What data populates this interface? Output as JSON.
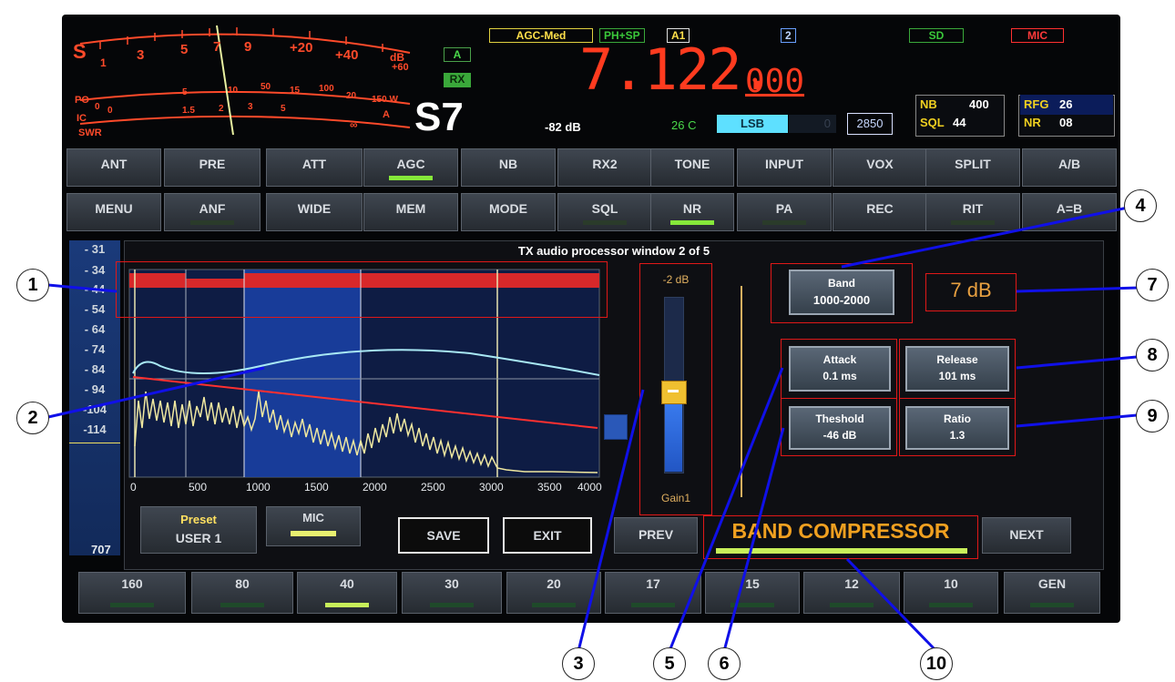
{
  "meter": {
    "s_label": "S",
    "s_scale": [
      "1",
      "3",
      "5",
      "7",
      "9",
      "+20",
      "+40",
      "dB"
    ],
    "db60": "+60",
    "po_label": "PO",
    "po_scale": [
      "0",
      "5",
      "10",
      "50",
      "15",
      "100",
      "20",
      "150 W"
    ],
    "ic_label": "IC",
    "ic_scale": [
      "0",
      "1.5",
      "2",
      "3",
      "5",
      "A"
    ],
    "swr_label": "SWR",
    "swr_inf": "∞",
    "s_reading": "S7",
    "db_reading": "-82 dB"
  },
  "status": {
    "vfo_a": "A",
    "rx": "RX",
    "agc": "AGC-Med",
    "phsp": "PH+SP",
    "a1": "A1",
    "two": "2",
    "sd": "SD",
    "mic": "MIC",
    "frequency_main": "7.122.",
    "frequency_sub": "000",
    "temp": "26 C",
    "mode": "LSB",
    "mode_zero": "0",
    "bandwidth": "2850",
    "nb_label": "NB",
    "nb_value": "400",
    "sql_label": "SQL",
    "sql_value": "44",
    "rfg_label": "RFG",
    "rfg_value": "26",
    "nr_label": "NR",
    "nr_value": "08"
  },
  "row1": [
    "ANT",
    "PRE",
    "ATT",
    "AGC",
    "NB",
    "RX2",
    "TONE",
    "INPUT",
    "VOX",
    "SPLIT",
    "A/B"
  ],
  "row2": [
    "MENU",
    "ANF",
    "WIDE",
    "MEM",
    "MODE",
    "SQL",
    "NR",
    "PA",
    "REC",
    "RIT",
    "A=B"
  ],
  "panel": {
    "title": "TX audio processor window 2 of 5",
    "y_labels": [
      "- 31",
      "- 34",
      "- 44",
      "- 54",
      "- 64",
      "- 74",
      "- 84",
      "- 94",
      "-104",
      "-114"
    ],
    "x_labels": [
      "0",
      "500",
      "1000",
      "1500",
      "2000",
      "2500",
      "3000",
      "3500",
      "4000"
    ],
    "slider_top": "-2 dB",
    "slider_bottom": "Gain1",
    "band_label": "Band",
    "band_value": "1000-2000",
    "gain_readout": "7  dB",
    "attack_label": "Attack",
    "attack_value": "0.1 ms",
    "release_label": "Release",
    "release_value": "101 ms",
    "threshold_label": "Theshold",
    "threshold_value": "-46 dB",
    "ratio_label": "Ratio",
    "ratio_value": "1.3",
    "preset_label": "Preset",
    "preset_value": "USER 1",
    "mic_label": "MIC",
    "save": "SAVE",
    "exit": "EXIT",
    "prev": "PREV",
    "next": "NEXT",
    "compressor": "BAND  COMPRESSOR",
    "side_value": "707"
  },
  "bands": [
    "160",
    "80",
    "40",
    "30",
    "20",
    "17",
    "15",
    "12",
    "10",
    "GEN"
  ],
  "callouts": [
    "1",
    "2",
    "3",
    "4",
    "5",
    "6",
    "7",
    "8",
    "9",
    "10"
  ],
  "colors": {
    "meter_red": "#ff4a2a",
    "frequency": "#ff3b1f",
    "indicator_green": "#86e83a",
    "callout_line": "#1010e8",
    "highlight_box": "#e01818",
    "compressor_text": "#f0a020"
  }
}
